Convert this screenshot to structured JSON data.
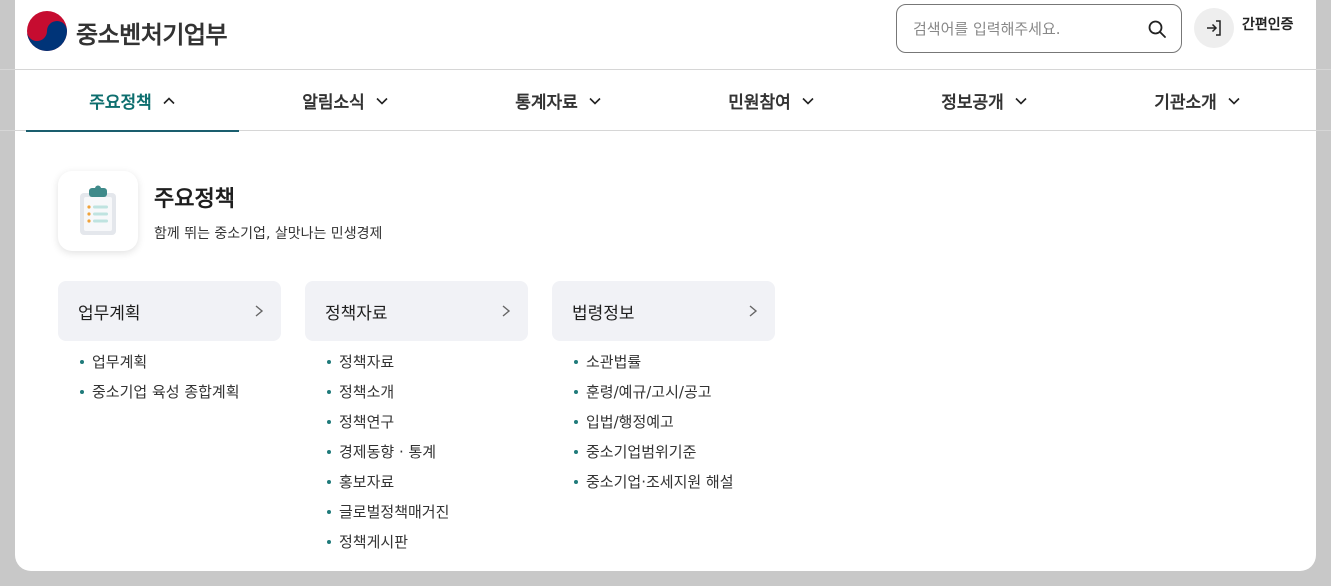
{
  "header": {
    "logo_text": "중소벤처기업부",
    "search_placeholder": "검색어를 입력해주세요.",
    "login_label": "간편인증"
  },
  "nav": {
    "items": [
      {
        "label": "주요정책",
        "active": true
      },
      {
        "label": "알림소식",
        "active": false
      },
      {
        "label": "통계자료",
        "active": false
      },
      {
        "label": "민원참여",
        "active": false
      },
      {
        "label": "정보공개",
        "active": false
      },
      {
        "label": "기관소개",
        "active": false
      }
    ]
  },
  "intro": {
    "title": "주요정책",
    "description": "함께 뛰는 중소기업, 살맛나는 민생경제"
  },
  "columns": [
    {
      "title": "업무계획",
      "links": [
        "업무계획",
        "중소기업 육성 종합계획"
      ]
    },
    {
      "title": "정책자료",
      "links": [
        "정책자료",
        "정책소개",
        "정책연구",
        "경제동향 · 통계",
        "홍보자료",
        "글로벌정책매거진",
        "정책게시판"
      ]
    },
    {
      "title": "법령정보",
      "links": [
        "소관법률",
        "훈령/예규/고시/공고",
        "입법/행정예고",
        "중소기업범위기준",
        "중소기업·조세지원 해설"
      ]
    }
  ],
  "colors": {
    "accent": "#0d6e6e",
    "bullet": "#1f7a7a",
    "column_header_bg": "#f1f2f6"
  }
}
